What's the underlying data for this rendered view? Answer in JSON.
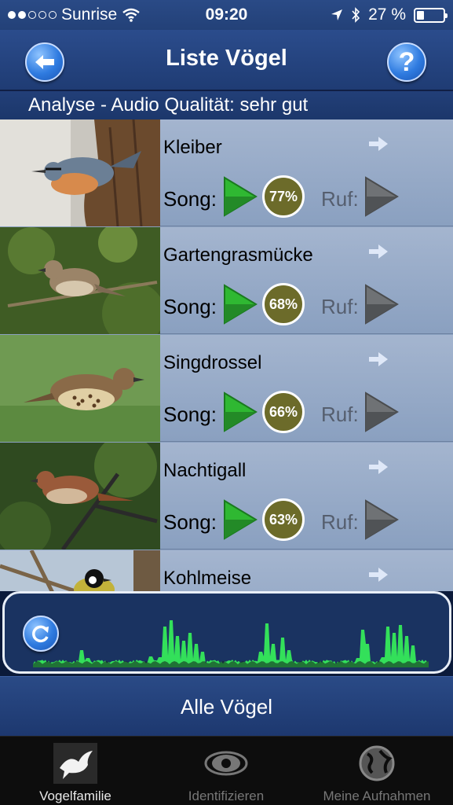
{
  "status_bar": {
    "carrier": "Sunrise",
    "time": "09:20",
    "battery": "27 %",
    "battery_level": 0.27,
    "signal_dots_filled": 2,
    "signal_dots_total": 5
  },
  "header": {
    "title": "Liste Vögel",
    "back_icon": "back-arrow-icon",
    "help_label": "?"
  },
  "analysis": {
    "text": "Analyse - Audio Qualität: sehr gut"
  },
  "birds": [
    {
      "name": "Kleiber",
      "song_label": "Song:",
      "match": "77%",
      "ruf_label": "Ruf:"
    },
    {
      "name": "Gartengrasmücke",
      "song_label": "Song:",
      "match": "68%",
      "ruf_label": "Ruf:"
    },
    {
      "name": "Singdrossel",
      "song_label": "Song:",
      "match": "66%",
      "ruf_label": "Ruf:"
    },
    {
      "name": "Nachtigall",
      "song_label": "Song:",
      "match": "63%",
      "ruf_label": "Ruf:"
    },
    {
      "name": "Kohlmeise"
    }
  ],
  "footer": {
    "all_birds_label": "Alle Vögel"
  },
  "tabs": [
    {
      "label": "Vogelfamilie",
      "icon": "bird-icon",
      "active": true
    },
    {
      "label": "Identifizieren",
      "icon": "eye-icon",
      "active": false
    },
    {
      "label": "Meine Aufnahmen",
      "icon": "globe-icon",
      "active": false
    }
  ],
  "colors": {
    "accent_blue": "#2f7be0",
    "match_badge": "#6c6b2a",
    "play_green": "#2fb832",
    "waveform_green": "#33e05a"
  }
}
